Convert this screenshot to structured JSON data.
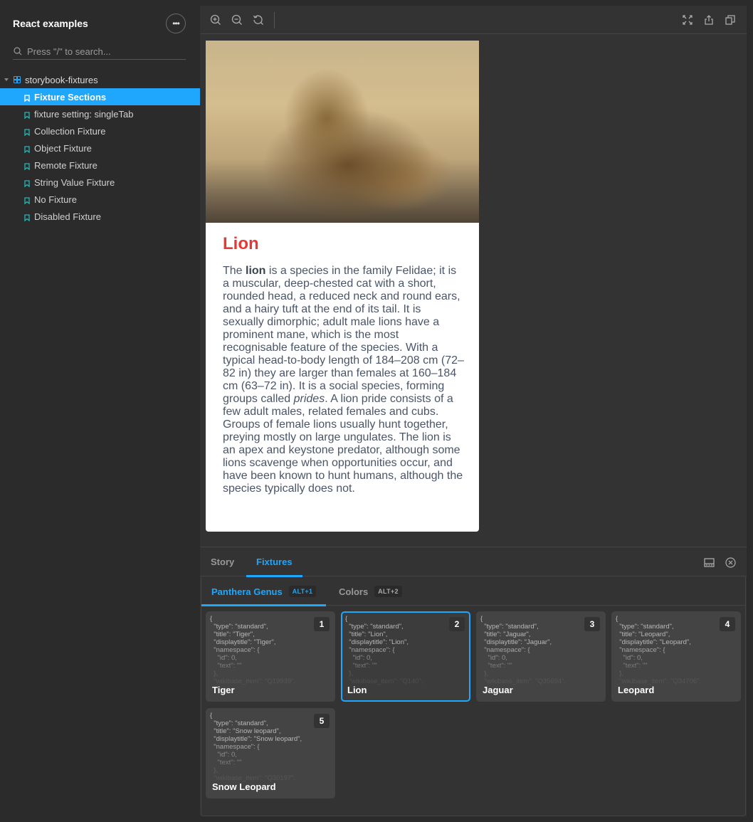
{
  "sidebar": {
    "title": "React examples",
    "more_label": "•••",
    "search_placeholder": "Press \"/\" to search...",
    "root": "storybook-fixtures",
    "stories": [
      {
        "label": "Fixture Sections",
        "active": true
      },
      {
        "label": "fixture setting: singleTab",
        "active": false
      },
      {
        "label": "Collection Fixture",
        "active": false
      },
      {
        "label": "Object Fixture",
        "active": false
      },
      {
        "label": "Remote Fixture",
        "active": false
      },
      {
        "label": "String Value Fixture",
        "active": false
      },
      {
        "label": "No Fixture",
        "active": false
      },
      {
        "label": "Disabled Fixture",
        "active": false
      }
    ]
  },
  "toolbar": {
    "left_icons": [
      "zoom-in-icon",
      "zoom-out-icon",
      "zoom-reset-icon"
    ],
    "right_icons": [
      "fullscreen-icon",
      "share-icon",
      "copy-icon"
    ]
  },
  "preview": {
    "image_alt": "Lion lying in dry grass",
    "title": "Lion",
    "title_color": "#e53935",
    "description_parts": [
      {
        "text": "The ",
        "style": "normal"
      },
      {
        "text": "lion",
        "style": "bold"
      },
      {
        "text": " is a species in the family Felidae; it is a muscular, deep-chested cat with a short, rounded head, a reduced neck and round ears, and a hairy tuft at the end of its tail. It is sexually dimorphic; adult male lions have a prominent mane, which is the most recognisable feature of the species. With a typical head-to-body length of 184–208 cm (72–82 in) they are larger than females at 160–184 cm (63–72 in). It is a social species, forming groups called ",
        "style": "normal"
      },
      {
        "text": "prides",
        "style": "italic"
      },
      {
        "text": ". A lion pride consists of a few adult males, related females and cubs. Groups of female lions usually hunt together, preying mostly on large ungulates. The lion is an apex and keystone predator, although some lions scavenge when opportunities occur, and have been known to hunt humans, although the species typically does not.",
        "style": "normal"
      }
    ]
  },
  "panel": {
    "tabs": [
      {
        "label": "Story",
        "active": false
      },
      {
        "label": "Fixtures",
        "active": true
      }
    ],
    "right_icons": [
      "panel-position-icon",
      "close-panel-icon"
    ],
    "fixture_tabs": [
      {
        "label": "Panthera Genus",
        "shortcut": "ALT+1",
        "active": true
      },
      {
        "label": "Colors",
        "shortcut": "ALT+2",
        "active": false
      }
    ],
    "fixtures": [
      {
        "index": "1",
        "name": "Tiger",
        "selected": false,
        "json": "{\n  \"type\": \"standard\",\n  \"title\": \"Tiger\",\n  \"displaytitle\": \"Tiger\",\n  \"namespace\": {\n    \"id\": 0,\n    \"text\": \"\"\n  },\n  \"wikibase_item\": \"Q19939\","
      },
      {
        "index": "2",
        "name": "Lion",
        "selected": true,
        "json": "{\n  \"type\": \"standard\",\n  \"title\": \"Lion\",\n  \"displaytitle\": \"Lion\",\n  \"namespace\": {\n    \"id\": 0,\n    \"text\": \"\"\n  },\n  \"wikibase_item\": \"Q140\","
      },
      {
        "index": "3",
        "name": "Jaguar",
        "selected": false,
        "json": "{\n  \"type\": \"standard\",\n  \"title\": \"Jaguar\",\n  \"displaytitle\": \"Jaguar\",\n  \"namespace\": {\n    \"id\": 0,\n    \"text\": \"\"\n  },\n  \"wikibase_item\": \"Q35694\","
      },
      {
        "index": "4",
        "name": "Leopard",
        "selected": false,
        "json": "{\n  \"type\": \"standard\",\n  \"title\": \"Leopard\",\n  \"displaytitle\": \"Leopard\",\n  \"namespace\": {\n    \"id\": 0,\n    \"text\": \"\"\n  },\n  \"wikibase_item\": \"Q34706\","
      },
      {
        "index": "5",
        "name": "Snow Leopard",
        "selected": false,
        "json": "{\n  \"type\": \"standard\",\n  \"title\": \"Snow leopard\",\n  \"displaytitle\": \"Snow leopard\",\n  \"namespace\": {\n    \"id\": 0,\n    \"text\": \"\"\n  },\n  \"wikibase_item\": \"Q30197\","
      }
    ]
  },
  "colors": {
    "accent": "#1ea7fd",
    "story_icon": "#2ab5b5",
    "background": "#2b2b2b",
    "panel": "#333333"
  }
}
